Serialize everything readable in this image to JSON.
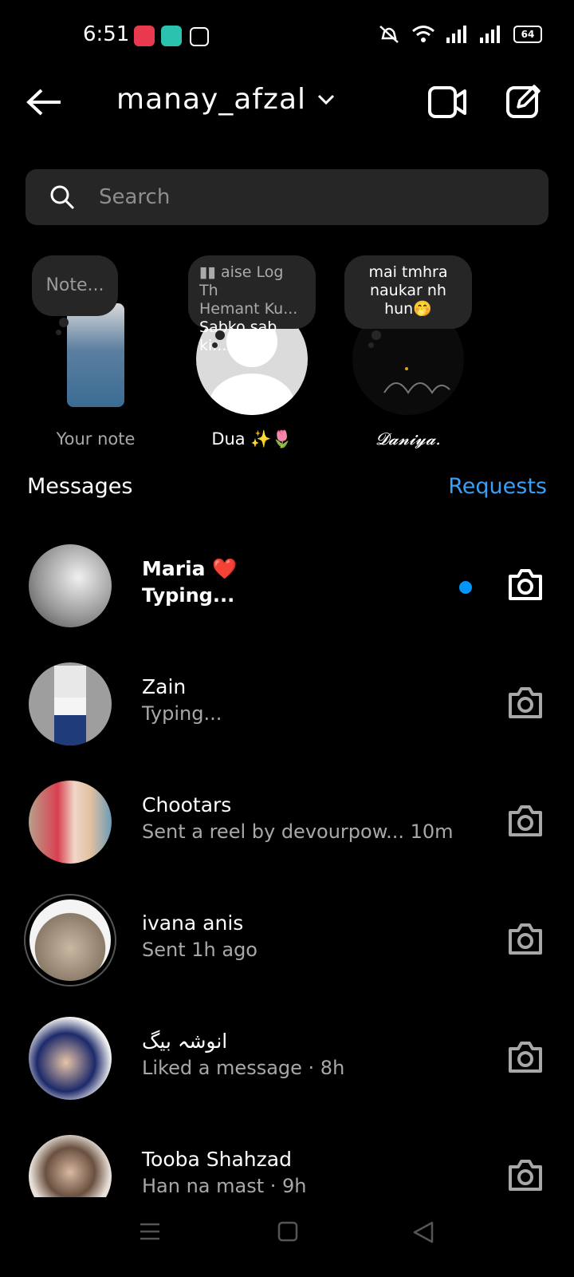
{
  "status": {
    "time": "6:51",
    "battery": "64"
  },
  "header": {
    "username": "manay_afzal"
  },
  "search": {
    "placeholder": "Search"
  },
  "notes": [
    {
      "bubble": "Note...",
      "label": "Your note"
    },
    {
      "bubble_line1": "aise Log Th",
      "bubble_line2": "Hemant Ku...",
      "bubble_line3": "Sabko sab ki...",
      "label": "Dua ✨🌷"
    },
    {
      "bubble_line1": "mai tmhra",
      "bubble_line2": "naukar nh",
      "bubble_line3": "hun🤭",
      "label": "𝓓𝓪𝓷𝓲𝔂𝓪."
    }
  ],
  "messages_section": {
    "title": "Messages",
    "requests": "Requests"
  },
  "conversations": [
    {
      "name": "Maria ❤️",
      "sub": "Typing...",
      "unread": true
    },
    {
      "name": "Zain",
      "sub": "Typing..."
    },
    {
      "name": "Chootars",
      "sub": "Sent a reel by devourpow... 10m"
    },
    {
      "name": "ivana anis",
      "sub": "Sent 1h ago"
    },
    {
      "name": "انوشہ بیگ",
      "sub": "Liked a message · 8h"
    },
    {
      "name": "Tooba Shahzad",
      "sub": "Han na mast · 9h"
    }
  ],
  "colors": {
    "accent": "#3a9ff5",
    "unread_dot": "#0095f6",
    "surface": "#262626"
  }
}
